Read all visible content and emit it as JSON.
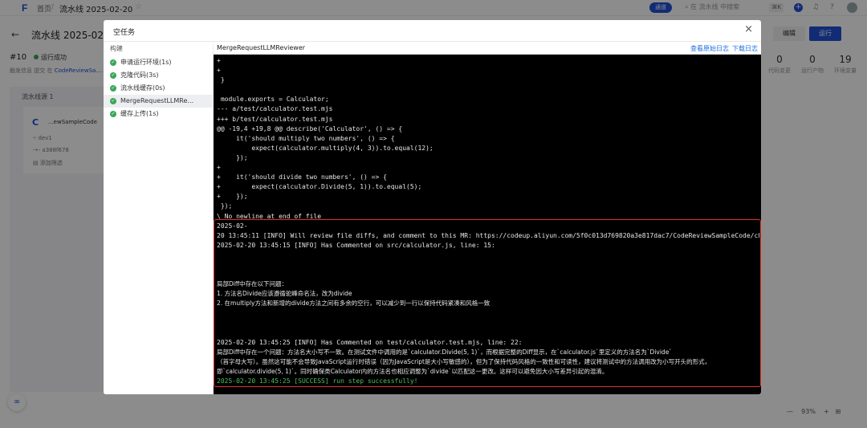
{
  "topbar": {
    "logo": "F",
    "home": "首页",
    "separator": "/",
    "current": "流水线 2025-02-20",
    "star_icon": "star-icon",
    "tag": "通道",
    "search_placeholder": "在 流水线 中搜索",
    "search_shortcut": "⌘K"
  },
  "header": {
    "back_icon": "←",
    "title": "流水线 2025-02-20",
    "edit_label": "编辑",
    "run_label": "运行"
  },
  "run": {
    "number": "#10",
    "status": "运行成功",
    "meta_prefix": "触发信息",
    "meta_mid": "提交 在",
    "meta_link": "CodeReviewSa...",
    "meta_suffix": "..."
  },
  "stats": [
    {
      "num": "0",
      "label": "代码变更"
    },
    {
      "num": "0",
      "label": "运行产物"
    },
    {
      "num": "19",
      "label": "环境变量"
    }
  ],
  "source": {
    "title": "流水线源",
    "count": "1",
    "name": "...ewSampleCode",
    "branch": "dev1",
    "commit": "a388f678",
    "filter": "添加筛选"
  },
  "zoom": {
    "minus": "—",
    "value": "93%",
    "plus": "+",
    "grid": "⊞"
  },
  "modal": {
    "title": "空任务",
    "close": "×",
    "steps_header": "构建",
    "steps": [
      {
        "label": "申请运行环境(1s)",
        "active": false
      },
      {
        "label": "克隆代码(3s)",
        "active": false
      },
      {
        "label": "流水线缓存(0s)",
        "active": false
      },
      {
        "label": "MergeRequestLLMRe...",
        "active": true
      },
      {
        "label": "缓存上传(1s)",
        "active": false
      }
    ],
    "log": {
      "title": "MergeRequestLLMReviewer",
      "view_raw": "查看原始日志",
      "download": "下载日志",
      "lines": [
        {
          "text": "+",
          "kind": "code"
        },
        {
          "text": "+",
          "kind": "code"
        },
        {
          "text": " }",
          "kind": "code"
        },
        {
          "text": "",
          "kind": "code"
        },
        {
          "text": " module.exports = Calculator;",
          "kind": "code"
        },
        {
          "text": "--- a/test/calculator.test.mjs",
          "kind": "code"
        },
        {
          "text": "+++ b/test/calculator.test.mjs",
          "kind": "code"
        },
        {
          "text": "@@ -19,4 +19,8 @@ describe('Calculator', () => {",
          "kind": "code"
        },
        {
          "text": "     it('should multiply two numbers', () => {",
          "kind": "code"
        },
        {
          "text": "         expect(calculator.multiply(4, 3)).to.equal(12);",
          "kind": "code"
        },
        {
          "text": "     });",
          "kind": "code"
        },
        {
          "text": "+",
          "kind": "code"
        },
        {
          "text": "+    it('should divide two numbers', () => {",
          "kind": "code"
        },
        {
          "text": "+        expect(calculator.Divide(5, 1)).to.equal(5);",
          "kind": "code"
        },
        {
          "text": "+    });",
          "kind": "code"
        },
        {
          "text": " });",
          "kind": "code"
        },
        {
          "text": "\\ No newline at end of file",
          "kind": "code"
        },
        {
          "text": "2025-02-",
          "kind": "code"
        },
        {
          "text": "20 13:45:11 [INFO] Will review file diffs, and comment to this MR: https://codeup.aliyun.com/5f0c013d769820a3e817dac7/CodeReviewSampleCode/cha",
          "kind": "code"
        },
        {
          "text": "2025-02-20 13:45:15 [INFO] Has Commented on src/calculator.js, line: 15:",
          "kind": "code"
        },
        {
          "text": "",
          "kind": "code"
        },
        {
          "text": "",
          "kind": "code"
        },
        {
          "text": "",
          "kind": "code"
        },
        {
          "text": "局部Diff中存在以下问题：",
          "kind": "cjk"
        },
        {
          "text": "1. 方法名Divide应该遵循驼峰命名法，改为divide",
          "kind": "cjk"
        },
        {
          "text": "2. 在multiply方法和新增的divide方法之间有多余的空行，可以减少到一行以保持代码紧凑和风格一致",
          "kind": "cjk"
        },
        {
          "text": "",
          "kind": "code"
        },
        {
          "text": "",
          "kind": "code"
        },
        {
          "text": "",
          "kind": "code"
        },
        {
          "text": "2025-02-20 13:45:25 [INFO] Has Commented on test/calculator.test.mjs, line: 22:",
          "kind": "code"
        },
        {
          "text": "局部Diff中存在一个问题：方法名大小写不一致。在测试文件中调用的是`calculator.Divide(5, 1)`，而根据完整的Diff显示，在`calculator.js`里定义的方法名为`Divide`",
          "kind": "cjk"
        },
        {
          "text": "（首字母大写）。虽然这可能不会导致JavaScript运行时错误（因为JavaScript是大小写敏感的），但为了保持代码风格的一致性和可读性，建议将测试中的方法调用改为小写开头的形式，",
          "kind": "cjk"
        },
        {
          "text": "即`calculator.divide(5, 1)`。同时确保类Calculator内的方法名也相应调整为`divide`以匹配这一更改。这样可以避免因大小写差异引起的混淆。",
          "kind": "cjk"
        },
        {
          "text": "2025-02-20 13:45:25 [SUCCESS] run step successfully!",
          "kind": "success"
        }
      ]
    }
  },
  "colors": {
    "brand": "#1f4fd6",
    "success": "#3aa757",
    "log_bg": "#000000",
    "highlight": "#e0302f"
  }
}
